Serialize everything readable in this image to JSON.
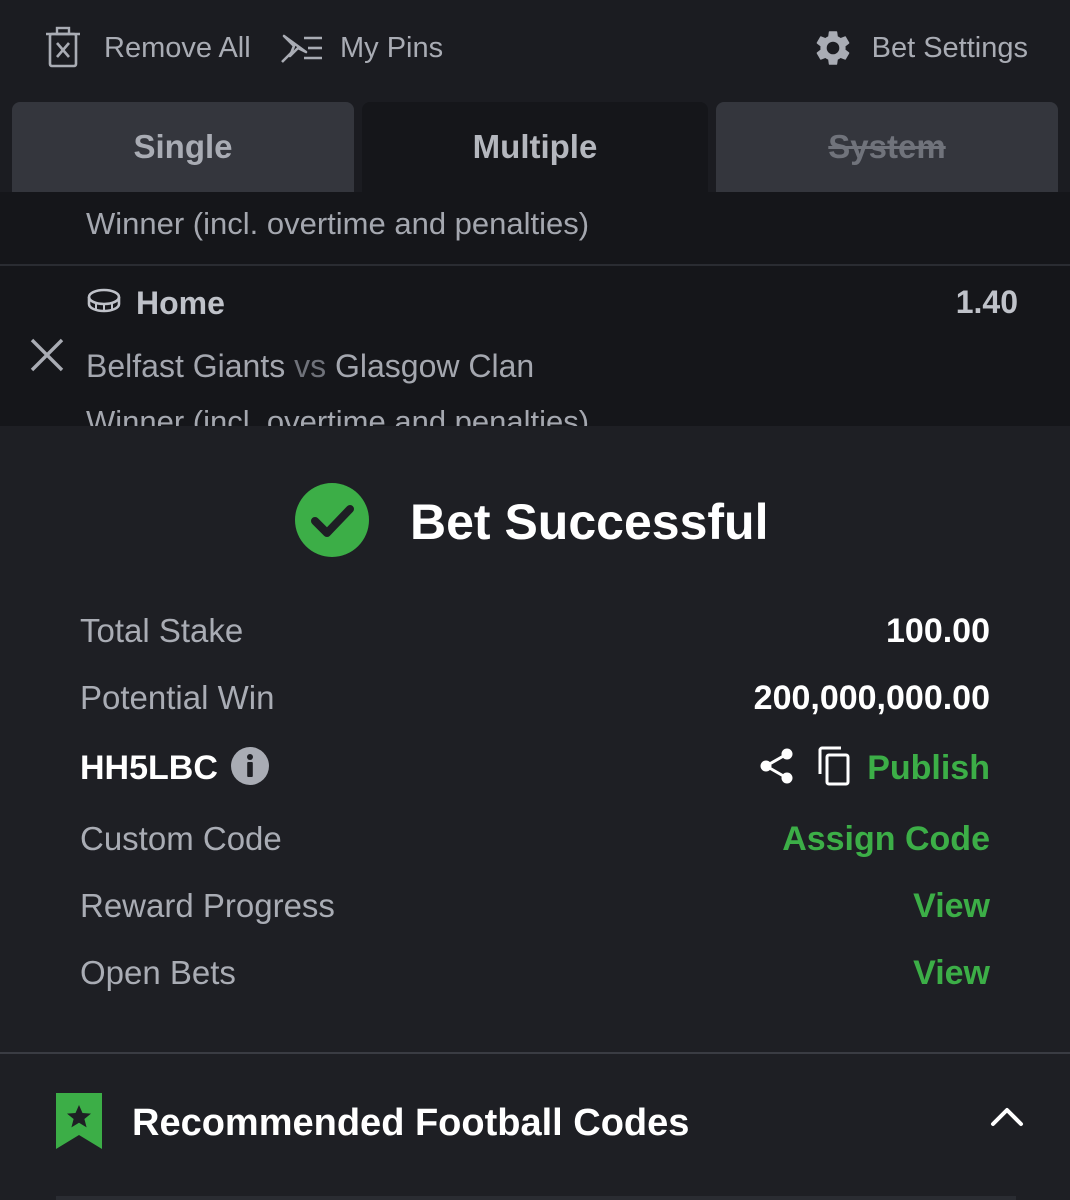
{
  "toolbar": {
    "remove_all": "Remove All",
    "my_pins": "My Pins",
    "bet_settings": "Bet Settings"
  },
  "tabs": {
    "single": "Single",
    "multiple": "Multiple",
    "system": "System",
    "active": "Multiple"
  },
  "betslip": {
    "market_top": "Winner (incl. overtime and penalties)",
    "selection": {
      "pick": "Home",
      "odds": "1.40",
      "home_team": "Belfast Giants",
      "vs": "vs",
      "away_team": "Glasgow Clan",
      "market": "Winner (incl. overtime and penalties)"
    }
  },
  "result": {
    "title": "Bet Successful",
    "total_stake_label": "Total Stake",
    "total_stake_value": "100.00",
    "potential_win_label": "Potential Win",
    "potential_win_value": "200,000,000.00",
    "booking_code": "HH5LBC",
    "publish_label": "Publish",
    "custom_code_label": "Custom Code",
    "assign_code_label": "Assign Code",
    "reward_progress_label": "Reward Progress",
    "reward_progress_action": "View",
    "open_bets_label": "Open Bets",
    "open_bets_action": "View"
  },
  "recommended": {
    "title": "Recommended Football Codes",
    "expanded": true
  },
  "colors": {
    "accent_green": "#3cae47",
    "background": "#1b1c21",
    "panel": "#1e1f24"
  },
  "icons": [
    "delete-list-icon",
    "pin-list-icon",
    "gear-icon",
    "hockey-puck-icon",
    "close-icon",
    "check-circle-icon",
    "info-icon",
    "share-icon",
    "copy-icon",
    "bookmark-star-icon",
    "chevron-up-icon"
  ]
}
